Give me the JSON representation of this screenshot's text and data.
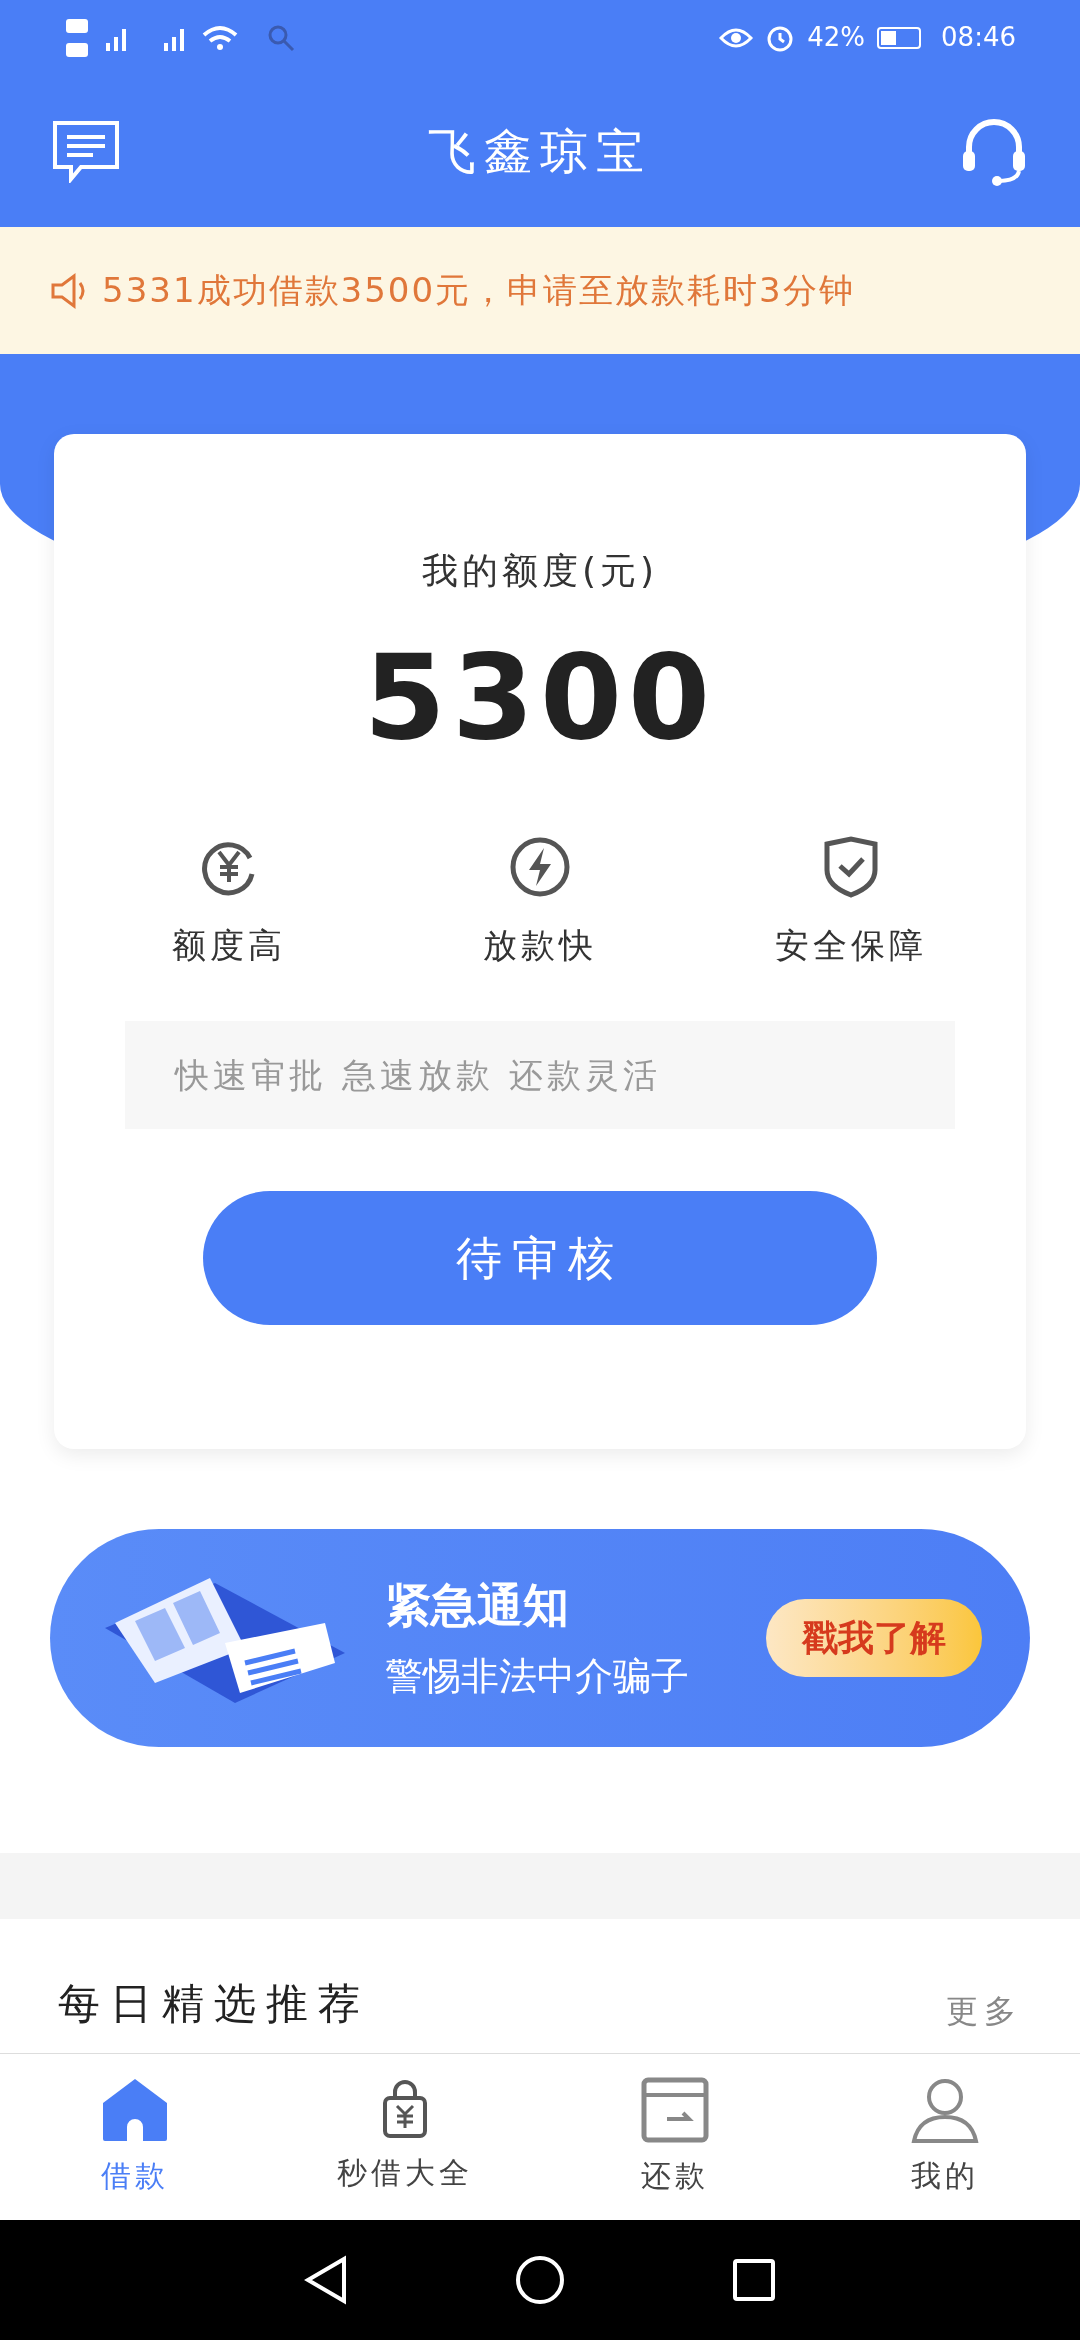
{
  "status_bar": {
    "battery": "42%",
    "time": "08:46"
  },
  "header": {
    "title": "飞鑫琼宝"
  },
  "notice": {
    "text": "5331成功借款3500元，申请至放款耗时3分钟"
  },
  "credit_card": {
    "label": "我的额度(元)",
    "amount": "5300",
    "features": [
      {
        "label": "额度高",
        "kind": "yen"
      },
      {
        "label": "放款快",
        "kind": "bolt"
      },
      {
        "label": "安全保障",
        "kind": "shield"
      }
    ],
    "slogan": "快速审批 急速放款 还款灵活",
    "button": "待审核"
  },
  "promo_banner": {
    "title": "紧急通知",
    "subtitle": "警惕非法中介骗子",
    "button": "戳我了解"
  },
  "section": {
    "title": "每日精选推荐",
    "more": "更多"
  },
  "tabs": [
    {
      "label": "借款",
      "kind": "home",
      "selected": true
    },
    {
      "label": "秒借大全",
      "kind": "bag",
      "selected": false
    },
    {
      "label": "还款",
      "kind": "card",
      "selected": false
    },
    {
      "label": "我的",
      "kind": "person",
      "selected": false
    }
  ]
}
